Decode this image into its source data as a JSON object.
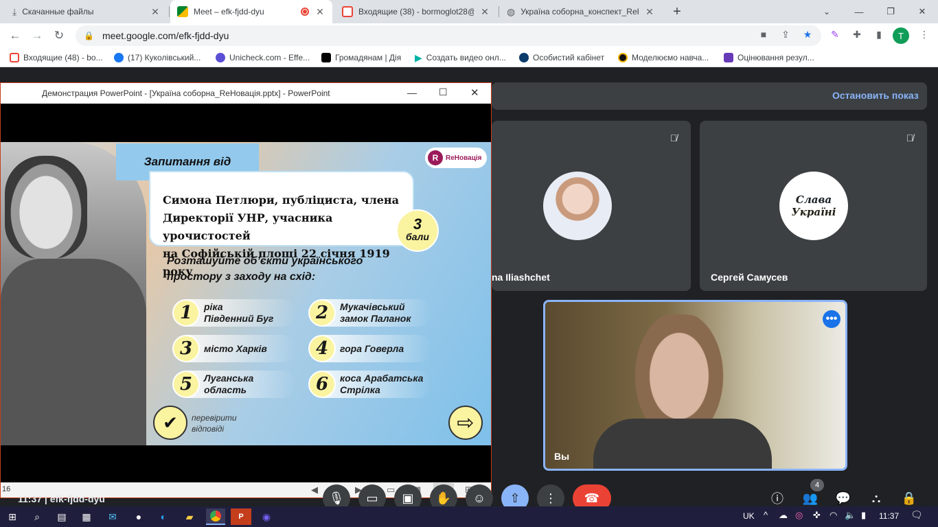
{
  "browser": {
    "tabs": [
      {
        "title": "Скачанные файлы",
        "icon": "download-icon"
      },
      {
        "title": "Meet – efk-fjdd-dyu",
        "icon": "google-meet-icon",
        "recording": true
      },
      {
        "title": "Входящие (38) - bormoglot28@",
        "icon": "gmail-icon"
      },
      {
        "title": "Україна соборна_конспект_ReH",
        "icon": "globe-icon"
      }
    ],
    "url": "meet.google.com/efk-fjdd-dyu",
    "profile_initial": "T",
    "bookmarks": [
      {
        "label": "Входящие (48) - bo...",
        "color": "#ea4335"
      },
      {
        "label": "(17) Куколівський...",
        "color": "#1877f2"
      },
      {
        "label": "Unicheck.com - Effe...",
        "color": "#5b4fd6"
      },
      {
        "label": "Громадянам | Дія",
        "color": "#000000"
      },
      {
        "label": "Создать видео онл...",
        "color": "#00b3a6"
      },
      {
        "label": "Особистий кабінет",
        "color": "#0b3a6b"
      },
      {
        "label": "Моделюємо навча...",
        "color": "#111111"
      },
      {
        "label": "Оцінювання резул...",
        "color": "#673ab7"
      }
    ]
  },
  "ppt": {
    "window_title": "Демонстрация PowerPoint - [Україна соборна_ReНовація.pptx] - PowerPoint",
    "slide_number": "16",
    "slide": {
      "banner": "Запитання від",
      "logo": "ReНовація",
      "question": [
        "Симона Петлюри, публіциста, члена",
        "Директорії УНР, учасника урочистостей",
        "на Софійській площі 22 січня 1919 року"
      ],
      "points_num": "3",
      "points_word": "бали",
      "task": [
        "Розташуйте об’єкти українського",
        "простору з заходу на схід:"
      ],
      "items": [
        {
          "num": "1",
          "line1": "ріка",
          "line2": "Південний Буг"
        },
        {
          "num": "2",
          "line1": "Мукачівський",
          "line2": "замок Паланок"
        },
        {
          "num": "3",
          "line1": "місто Харків",
          "line2": ""
        },
        {
          "num": "4",
          "line1": "гора Говерла",
          "line2": ""
        },
        {
          "num": "5",
          "line1": "Луганська",
          "line2": "область"
        },
        {
          "num": "6",
          "line1": "коса Арабатська",
          "line2": "Стрілка"
        }
      ],
      "check_line1": "перевірити",
      "check_line2": "відповіді"
    }
  },
  "meet": {
    "stop_share": "Остановить показ",
    "participants": [
      {
        "name": "na Iliashchet"
      },
      {
        "name": "Сергей Самусев",
        "avatar_text": "Слава Україні"
      },
      {
        "name": "Вы"
      }
    ],
    "meeting_label": "11:37  |  efk-fjdd-dyu",
    "people_count": "4"
  },
  "taskbar": {
    "lang": "UK",
    "time": "11:37"
  },
  "colors": {
    "meet_bg": "#202124",
    "tile_bg": "#3c4043",
    "accent_blue": "#8ab4f8",
    "end_call": "#ea4335",
    "ppt_red": "#c43e1c"
  }
}
